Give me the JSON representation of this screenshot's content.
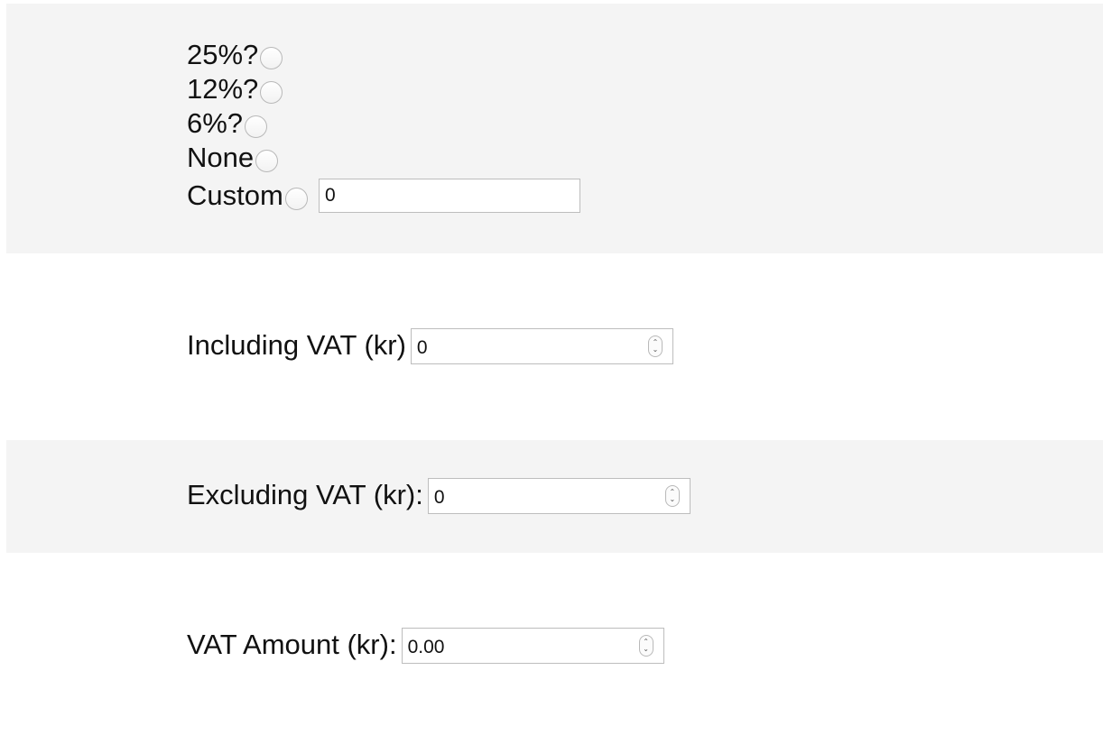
{
  "vat_rates": {
    "options": [
      {
        "label": "25%?"
      },
      {
        "label": "12%?"
      },
      {
        "label": "6%?"
      },
      {
        "label": "None"
      },
      {
        "label": "Custom"
      }
    ],
    "custom_value": "0"
  },
  "including_vat": {
    "label": "Including VAT (kr)",
    "value": "0"
  },
  "excluding_vat": {
    "label": "Excluding VAT (kr):",
    "value": "0"
  },
  "vat_amount": {
    "label": "VAT Amount (kr):",
    "value": "0.00"
  },
  "colors": {
    "band_gray": "#f4f4f4",
    "background": "#ffffff",
    "border": "#bdbdbd"
  }
}
